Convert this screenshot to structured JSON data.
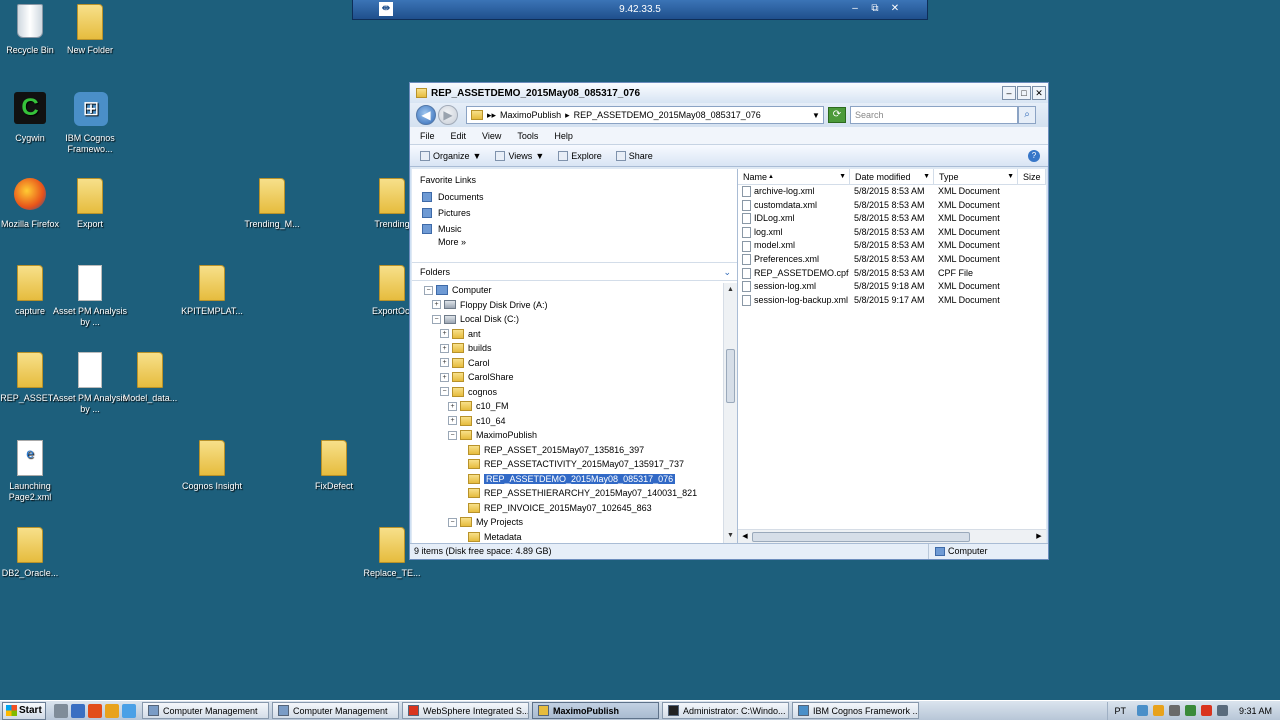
{
  "desktop": {
    "icons": [
      {
        "label": "Recycle Bin",
        "kind": "bin",
        "glyph": ""
      },
      {
        "label": "New Folder",
        "kind": "folder",
        "glyph": ""
      },
      {
        "label": "Cygwin",
        "kind": "cygwin",
        "glyph": "C"
      },
      {
        "label": "IBM Cognos Framewo...",
        "kind": "network",
        "glyph": "⊞"
      },
      {
        "label": "Mozilla Firefox",
        "kind": "firefox",
        "glyph": ""
      },
      {
        "label": "Export",
        "kind": "folder",
        "glyph": ""
      },
      {
        "label": "Trending_M...",
        "kind": "folder",
        "glyph": ""
      },
      {
        "label": "Trending",
        "kind": "folder",
        "glyph": ""
      },
      {
        "label": "capture",
        "kind": "folder",
        "glyph": ""
      },
      {
        "label": "Asset PM Analysis by ...",
        "kind": "doc",
        "glyph": ""
      },
      {
        "label": "KPITEMPLAT...",
        "kind": "folder",
        "glyph": ""
      },
      {
        "label": "ExportOct",
        "kind": "folder",
        "glyph": ""
      },
      {
        "label": "REP_ASSET...",
        "kind": "folder",
        "glyph": ""
      },
      {
        "label": "Asset PM Analysis by ...",
        "kind": "doc",
        "glyph": ""
      },
      {
        "label": "Model_data...",
        "kind": "folder",
        "glyph": ""
      },
      {
        "label": "Launching Page2.xml",
        "kind": "page",
        "glyph": "e"
      },
      {
        "label": "Cognos Insight",
        "kind": "folder",
        "glyph": ""
      },
      {
        "label": "FixDefect",
        "kind": "folder",
        "glyph": ""
      },
      {
        "label": "DB2_Oracle...",
        "kind": "folder",
        "glyph": ""
      },
      {
        "label": "Replace_TE...",
        "kind": "folder",
        "glyph": ""
      }
    ]
  },
  "remote_bar": {
    "title": "9.42.33.5",
    "pin": "⇹",
    "min": "–",
    "restore": "⧉",
    "close": "✕"
  },
  "window": {
    "title": "REP_ASSETDEMO_2015May08_085317_076",
    "buttons": {
      "min": "–",
      "max": "□",
      "close": "✕"
    },
    "nav": {
      "back": "◀",
      "forward": "▶"
    },
    "address": {
      "parts": [
        "MaximoPublish",
        "REP_ASSETDEMO_2015May08_085317_076"
      ],
      "sep": "▸",
      "lead": "▸▸"
    },
    "search_placeholder": "Search",
    "menu": [
      "File",
      "Edit",
      "View",
      "Tools",
      "Help"
    ],
    "commands": [
      {
        "label": "Organize",
        "drop": true
      },
      {
        "label": "Views",
        "drop": true
      },
      {
        "label": "Explore",
        "drop": false
      },
      {
        "label": "Share",
        "drop": false
      }
    ],
    "help_glyph": "?",
    "favorites": {
      "header": "Favorite Links",
      "items": [
        "Documents",
        "Pictures",
        "Music"
      ],
      "more": "More",
      "more_glyph": "»"
    },
    "folders_header": "Folders",
    "tree": [
      {
        "label": "Computer",
        "indent": 1,
        "exp": "−",
        "icon": "cmp",
        "selected": false
      },
      {
        "label": "Floppy Disk Drive (A:)",
        "indent": 2,
        "exp": "+",
        "icon": "drv",
        "selected": false
      },
      {
        "label": "Local Disk (C:)",
        "indent": 2,
        "exp": "−",
        "icon": "drv",
        "selected": false
      },
      {
        "label": "ant",
        "indent": 3,
        "exp": "+",
        "icon": "tf",
        "selected": false
      },
      {
        "label": "builds",
        "indent": 3,
        "exp": "+",
        "icon": "tf",
        "selected": false
      },
      {
        "label": "Carol",
        "indent": 3,
        "exp": "+",
        "icon": "tf",
        "selected": false
      },
      {
        "label": "CarolShare",
        "indent": 3,
        "exp": "+",
        "icon": "tf",
        "selected": false
      },
      {
        "label": "cognos",
        "indent": 3,
        "exp": "−",
        "icon": "tf",
        "selected": false
      },
      {
        "label": "c10_FM",
        "indent": 4,
        "exp": "+",
        "icon": "tf",
        "selected": false
      },
      {
        "label": "c10_64",
        "indent": 4,
        "exp": "+",
        "icon": "tf",
        "selected": false
      },
      {
        "label": "MaximoPublish",
        "indent": 4,
        "exp": "−",
        "icon": "tf",
        "selected": false
      },
      {
        "label": "REP_ASSET_2015May07_135816_397",
        "indent": 5,
        "exp": "",
        "icon": "tf",
        "selected": false
      },
      {
        "label": "REP_ASSETACTIVITY_2015May07_135917_737",
        "indent": 5,
        "exp": "",
        "icon": "tf",
        "selected": false
      },
      {
        "label": "REP_ASSETDEMO_2015May08_085317_076",
        "indent": 5,
        "exp": "",
        "icon": "tf",
        "selected": true
      },
      {
        "label": "REP_ASSETHIERARCHY_2015May07_140031_821",
        "indent": 5,
        "exp": "",
        "icon": "tf",
        "selected": false
      },
      {
        "label": "REP_INVOICE_2015May07_102645_863",
        "indent": 5,
        "exp": "",
        "icon": "tf",
        "selected": false
      },
      {
        "label": "My Projects",
        "indent": 4,
        "exp": "−",
        "icon": "tf",
        "selected": false
      },
      {
        "label": "Metadata",
        "indent": 5,
        "exp": "",
        "icon": "tf",
        "selected": false
      }
    ],
    "columns": [
      "Name",
      "Date modified",
      "Type",
      "Size"
    ],
    "sort_glyph": "▲",
    "files": [
      {
        "name": "archive-log.xml",
        "date": "5/8/2015 8:53 AM",
        "type": "XML Document"
      },
      {
        "name": "customdata.xml",
        "date": "5/8/2015 8:53 AM",
        "type": "XML Document"
      },
      {
        "name": "IDLog.xml",
        "date": "5/8/2015 8:53 AM",
        "type": "XML Document"
      },
      {
        "name": "log.xml",
        "date": "5/8/2015 8:53 AM",
        "type": "XML Document"
      },
      {
        "name": "model.xml",
        "date": "5/8/2015 8:53 AM",
        "type": "XML Document"
      },
      {
        "name": "Preferences.xml",
        "date": "5/8/2015 8:53 AM",
        "type": "XML Document"
      },
      {
        "name": "REP_ASSETDEMO.cpf",
        "date": "5/8/2015 8:53 AM",
        "type": "CPF File"
      },
      {
        "name": "session-log.xml",
        "date": "5/8/2015 9:18 AM",
        "type": "XML Document"
      },
      {
        "name": "session-log-backup.xml",
        "date": "5/8/2015 9:17 AM",
        "type": "XML Document"
      }
    ],
    "status": "9 items (Disk free space: 4.89 GB)",
    "status_right": "Computer"
  },
  "taskbar": {
    "start": "Start",
    "quicklaunch_colors": [
      "#7f8c99",
      "#3a6fc2",
      "#e24d1a",
      "#e8a21c",
      "#4aa0e6"
    ],
    "buttons": [
      {
        "label": "Computer Management",
        "color": "#7a9cc6",
        "active": false
      },
      {
        "label": "Computer Management",
        "color": "#7a9cc6",
        "active": false
      },
      {
        "label": "WebSphere Integrated S...",
        "color": "#d9341e",
        "active": false
      },
      {
        "label": "MaximoPublish",
        "color": "#e6bc3e",
        "active": true
      },
      {
        "label": "Administrator: C:\\Windo...",
        "color": "#222222",
        "active": false
      },
      {
        "label": "IBM Cognos Framework ...",
        "color": "#4a8fc8",
        "active": false
      }
    ],
    "lang": "PT",
    "tray_colors": [
      "#4a8fc8",
      "#e8a21c",
      "#6a6a6a",
      "#3a8a3a",
      "#d9341e",
      "#5a6b7c"
    ],
    "clock": "9:31 AM"
  },
  "colors": {
    "desktop": "#1d5f7c",
    "selection": "#3169c6"
  }
}
